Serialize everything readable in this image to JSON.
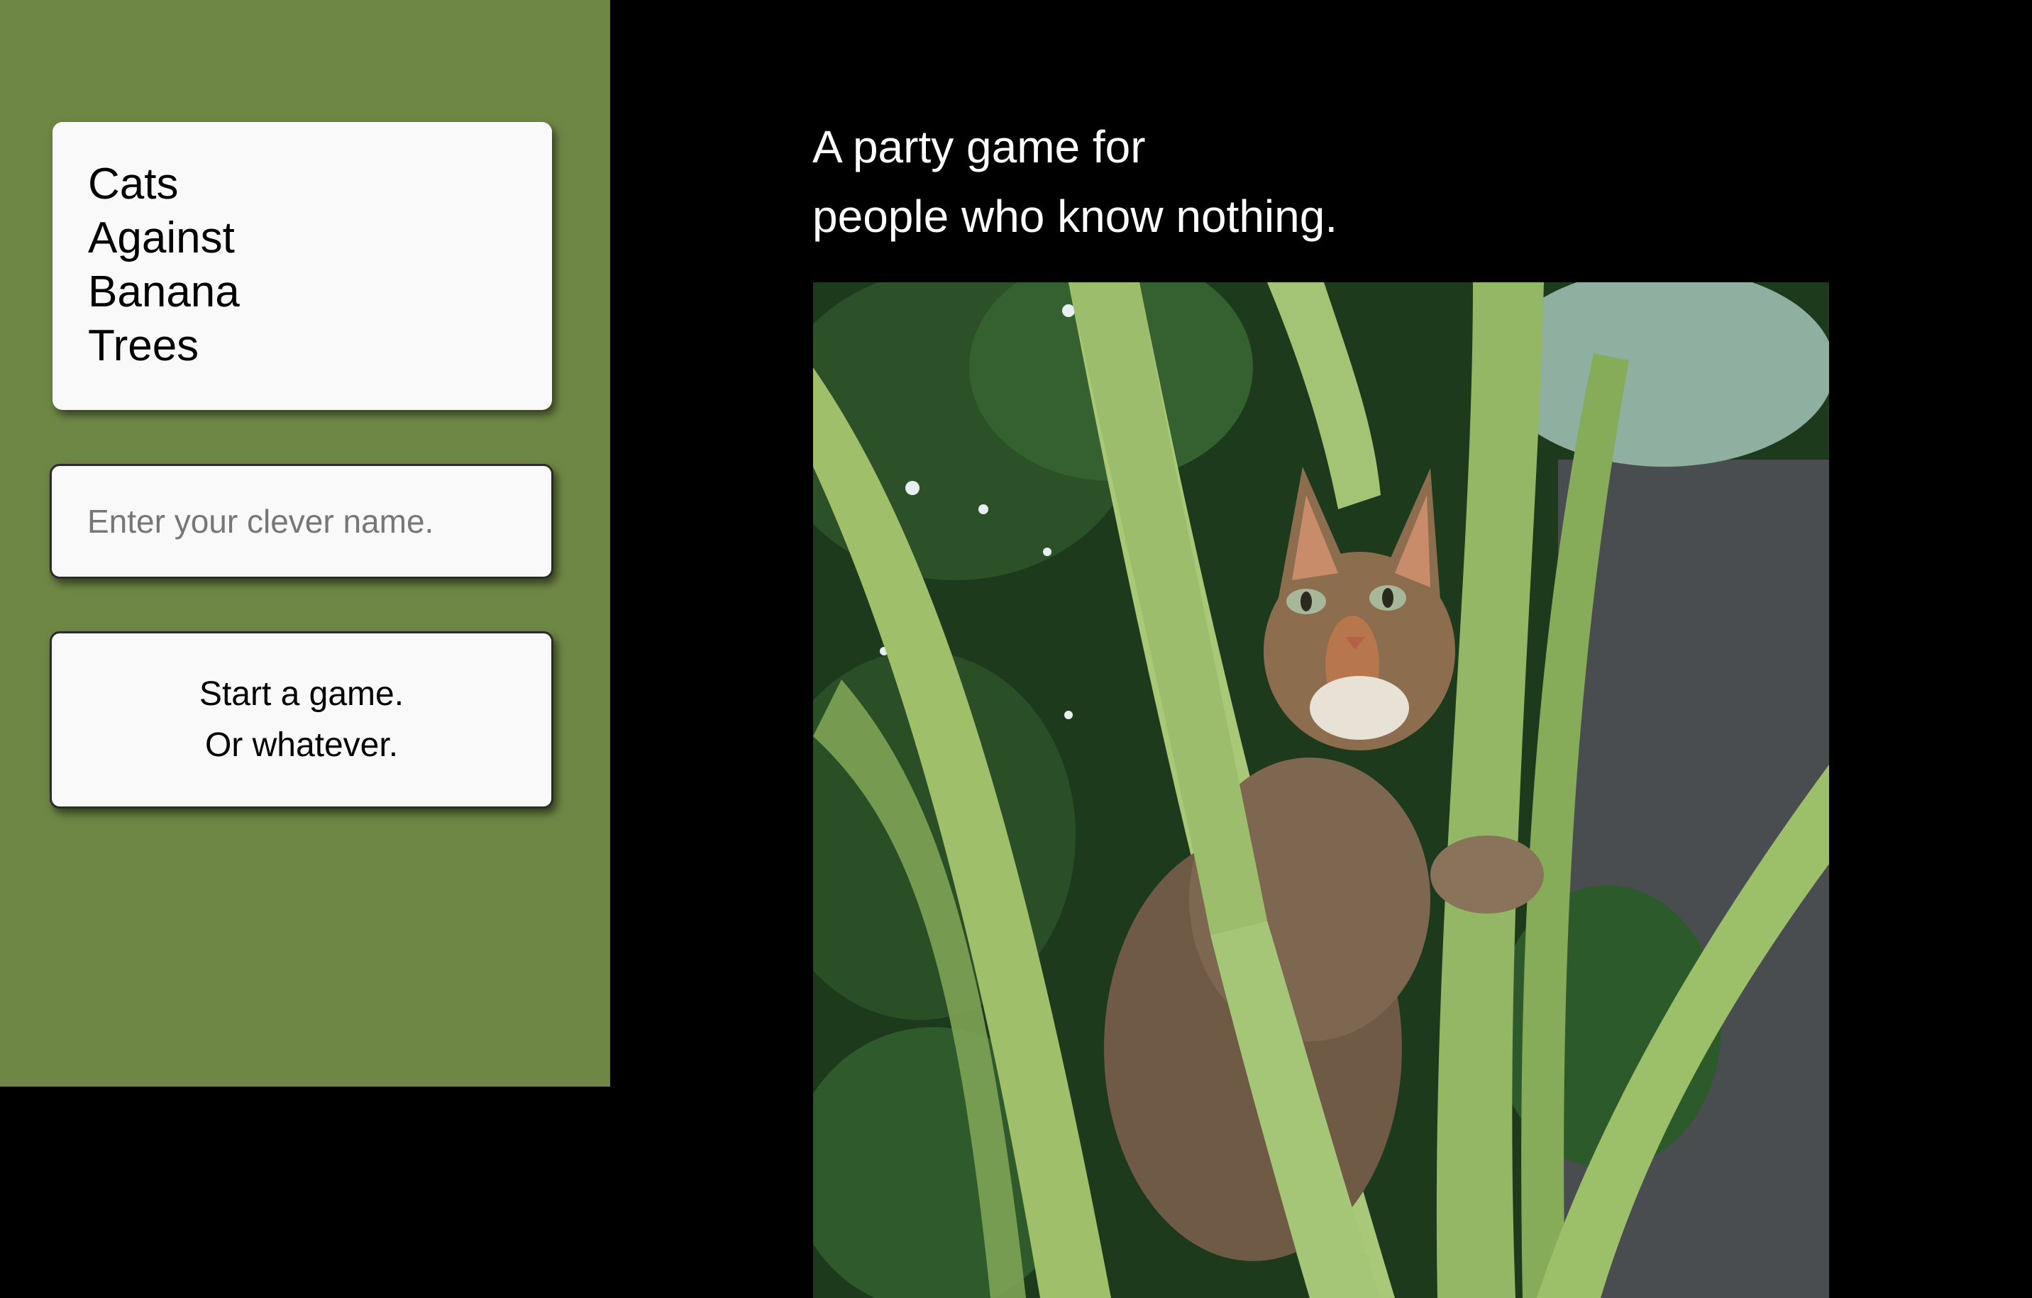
{
  "logo": {
    "lines": [
      "Cats",
      "Against",
      "Banana",
      "Trees"
    ]
  },
  "name_input": {
    "placeholder": "Enter your clever name.",
    "value": ""
  },
  "start_button": {
    "line1": "Start a game.",
    "line2": "Or whatever."
  },
  "tagline": {
    "line1": "A party game for",
    "line2": "people who know nothing."
  },
  "photo": {
    "subject": "cat-in-banana-tree"
  },
  "colors": {
    "sidebar_bg": "#6f8745",
    "page_bg": "#000000",
    "card_bg": "#f9f9f9"
  }
}
